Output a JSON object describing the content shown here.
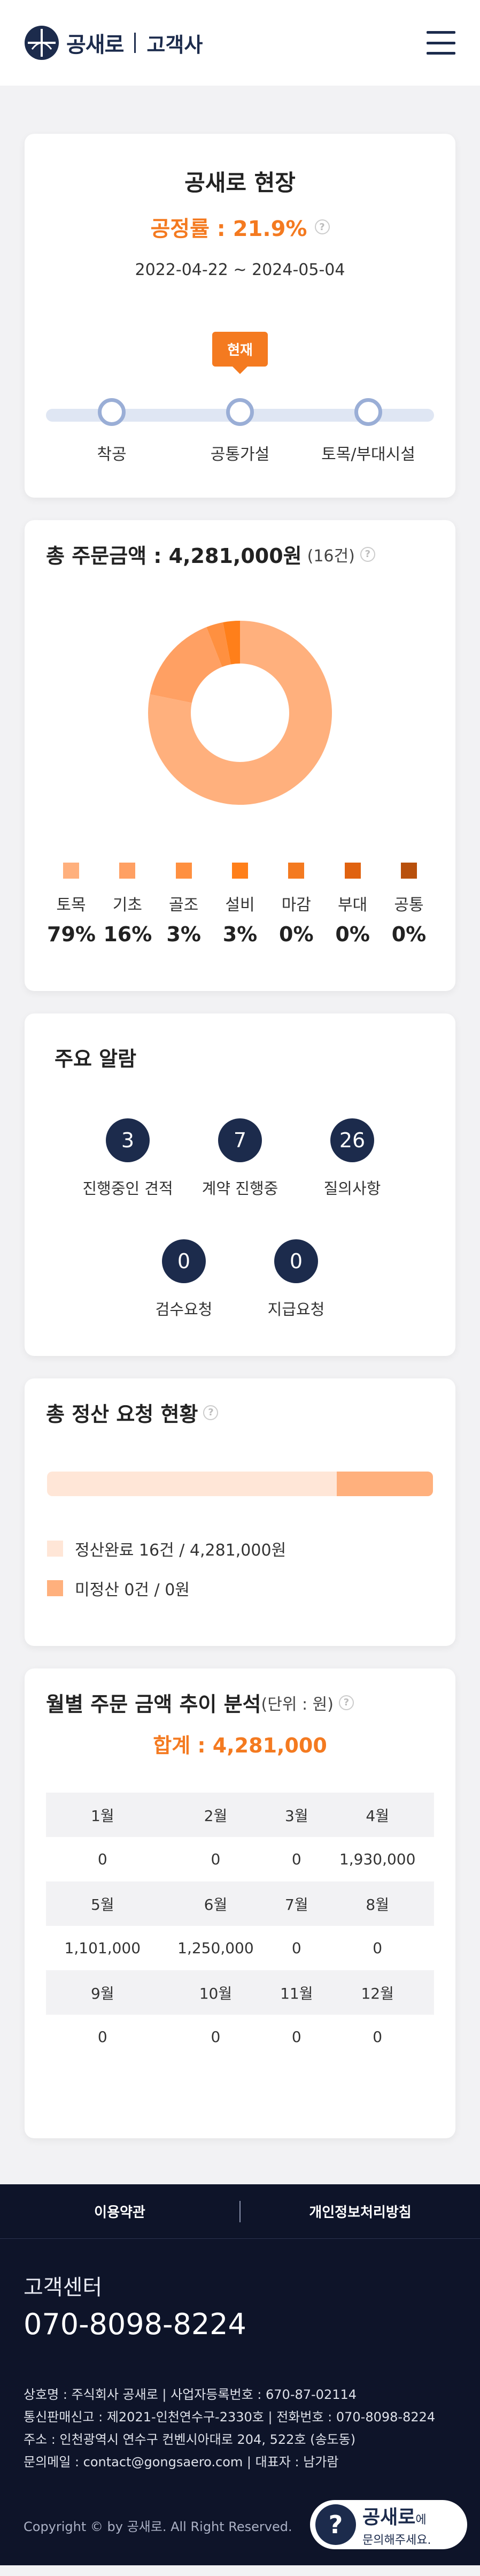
{
  "header": {
    "brand": "공새로",
    "sub": "고객사"
  },
  "site": {
    "title": "공새로 현장",
    "rate": "공정률 : 21.9%",
    "period": "2022-04-22 ~ 2024-05-04",
    "badge": "현재",
    "stages": [
      "착공",
      "공통가설",
      "토목/부대시설"
    ]
  },
  "orders": {
    "title": "총 주문금액 : 4,281,000원",
    "count": "(16건)",
    "chart_data": {
      "type": "pie",
      "categories": [
        "토목",
        "기초",
        "골조",
        "설비",
        "마감",
        "부대",
        "공통"
      ],
      "values": [
        79,
        16,
        3,
        3,
        0,
        0,
        0
      ],
      "colors": [
        "#ffb07d",
        "#ffa063",
        "#ff9040",
        "#ff7f1a",
        "#f47a20",
        "#e0620f",
        "#b8500c"
      ]
    },
    "legend": [
      {
        "name": "토목",
        "pct": "79%"
      },
      {
        "name": "기초",
        "pct": "16%"
      },
      {
        "name": "골조",
        "pct": "3%"
      },
      {
        "name": "설비",
        "pct": "3%"
      },
      {
        "name": "마감",
        "pct": "0%"
      },
      {
        "name": "부대",
        "pct": "0%"
      },
      {
        "name": "공통",
        "pct": "0%"
      }
    ]
  },
  "alerts": {
    "title": "주요 알람",
    "items": [
      {
        "count": "3",
        "label": "진행중인 견적"
      },
      {
        "count": "7",
        "label": "계약 진행중"
      },
      {
        "count": "26",
        "label": "질의사항"
      },
      {
        "count": "0",
        "label": "검수요청"
      },
      {
        "count": "0",
        "label": "지급요청"
      }
    ]
  },
  "settle": {
    "title": "총 정산 요청 현황",
    "done_fraction": 0.75,
    "done": "정산완료 16건 / 4,281,000원",
    "pending": "미정산 0건 / 0원"
  },
  "monthly": {
    "title": "월별 주문 금액 추이 분석",
    "unit": "(단위 : 원)",
    "total": "합계 : 4,281,000",
    "rows": [
      [
        "1월",
        "2월",
        "3월",
        "4월"
      ],
      [
        "0",
        "0",
        "0",
        "1,930,000"
      ],
      [
        "5월",
        "6월",
        "7월",
        "8월"
      ],
      [
        "1,101,000",
        "1,250,000",
        "0",
        "0"
      ],
      [
        "9월",
        "10월",
        "11월",
        "12월"
      ],
      [
        "0",
        "0",
        "0",
        "0"
      ]
    ]
  },
  "footer": {
    "terms": "이용약관",
    "privacy": "개인정보처리방침",
    "center_title": "고객센터",
    "phone": "070-8098-8224",
    "info": [
      "상호명 : 주식회사 공새로 | 사업자등록번호 : 670-87-02114",
      "통신판매신고 : 제2021-인천연수구-2330호 | 전화번호 : 070-8098-8224",
      "주소 : 인천광역시 연수구 컨벤시아대로 204, 522호 (송도동)",
      "문의메일 : contact@gongsaero.com | 대표자 : 남가람"
    ],
    "copyright": "Copyright © by 공새로. All Right Reserved.",
    "chat_brand": "공새로",
    "chat_suffix": "에",
    "chat_sub": "문의해주세요."
  }
}
